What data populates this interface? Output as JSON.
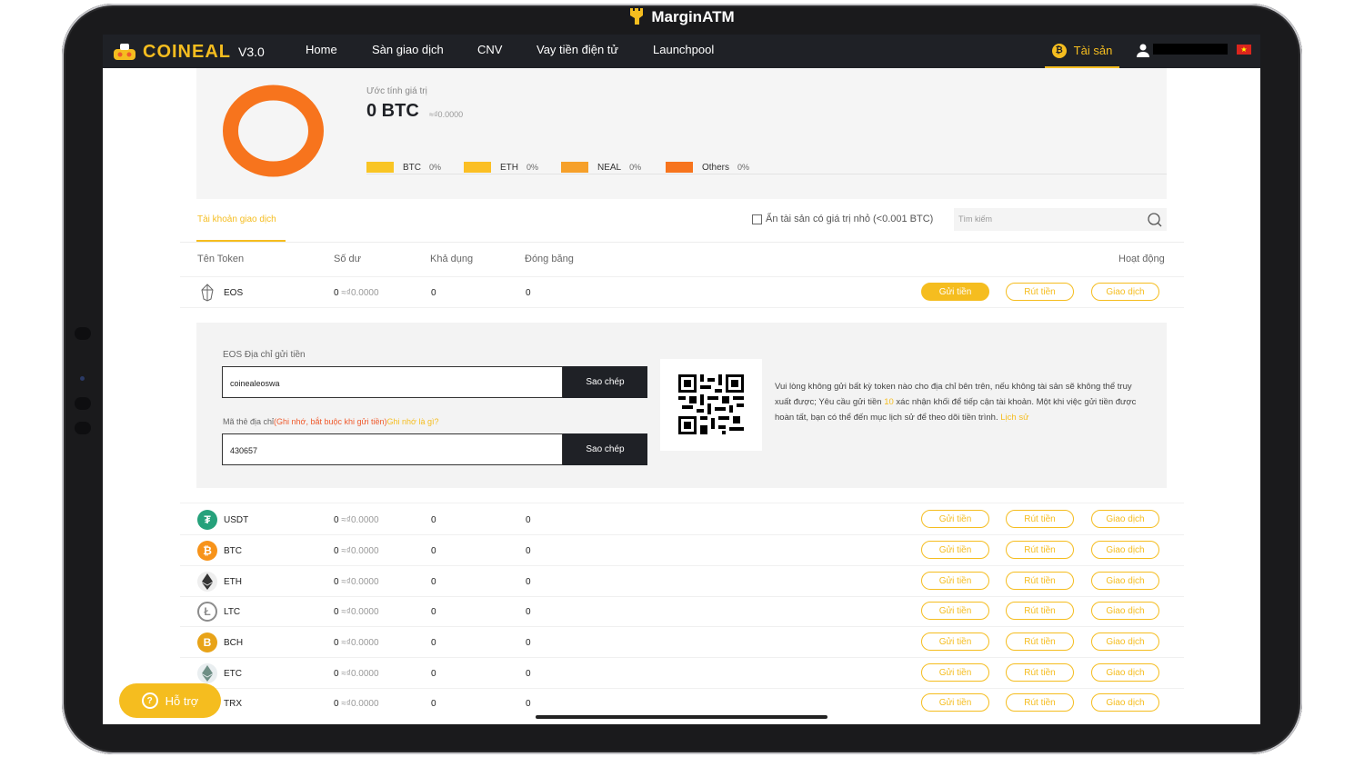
{
  "device": {
    "title": "MarginATM"
  },
  "brand": {
    "name": "COINEAL",
    "version": "V3.0"
  },
  "nav": {
    "items": [
      "Home",
      "Sàn giao dịch",
      "CNV",
      "Vay tiền điện tử",
      "Launchpool"
    ],
    "assets_label": "Tài sản",
    "flag": "★"
  },
  "summary": {
    "label": "Ước tính giá trị",
    "value": "0 BTC",
    "fiat": "≈₫0.0000",
    "legend": [
      {
        "name": "BTC",
        "pct": "0%",
        "color": "#f9c524"
      },
      {
        "name": "ETH",
        "pct": "0%",
        "color": "#fbbf24"
      },
      {
        "name": "NEAL",
        "pct": "0%",
        "color": "#f6a02a"
      },
      {
        "name": "Others",
        "pct": "0%",
        "color": "#f7741d"
      }
    ],
    "donut_color": "#f7741d"
  },
  "tabs": {
    "active": "Tài khoản giao dịch"
  },
  "filters": {
    "hide_small": "Ẩn tài sản có giá trị nhỏ (<0.001 BTC)",
    "search_placeholder": "Tìm kiếm"
  },
  "table": {
    "headers": [
      "Tên Token",
      "Số dư",
      "Khả dụng",
      "Đóng băng",
      "Hoạt động"
    ],
    "actions": [
      "Gửi tiền",
      "Rút tiền",
      "Giao dịch"
    ],
    "rows": [
      {
        "name": "EOS",
        "balance": "0",
        "fiat": "≈₫0.0000",
        "available": "0",
        "frozen": "0",
        "icon": "eos-icon"
      },
      {
        "name": "USDT",
        "balance": "0",
        "fiat": "≈₫0.0000",
        "available": "0",
        "frozen": "0",
        "icon": "usdt-icon"
      },
      {
        "name": "BTC",
        "balance": "0",
        "fiat": "≈₫0.0000",
        "available": "0",
        "frozen": "0",
        "icon": "btc-icon"
      },
      {
        "name": "ETH",
        "balance": "0",
        "fiat": "≈₫0.0000",
        "available": "0",
        "frozen": "0",
        "icon": "eth-icon"
      },
      {
        "name": "LTC",
        "balance": "0",
        "fiat": "≈₫0.0000",
        "available": "0",
        "frozen": "0",
        "icon": "ltc-icon"
      },
      {
        "name": "BCH",
        "balance": "0",
        "fiat": "≈₫0.0000",
        "available": "0",
        "frozen": "0",
        "icon": "bch-icon"
      },
      {
        "name": "ETC",
        "balance": "0",
        "fiat": "≈₫0.0000",
        "available": "0",
        "frozen": "0",
        "icon": "etc-icon"
      },
      {
        "name": "TRX",
        "balance": "0",
        "fiat": "≈₫0.0000",
        "available": "0",
        "frozen": "0",
        "icon": "trx-icon"
      }
    ]
  },
  "deposit": {
    "address_label": "EOS Địa chỉ gửi tiền",
    "address_value": "coinealeoswa",
    "copy_label": "Sao chép",
    "memo_label": "Mã thẻ địa chỉ",
    "memo_warning": "(Ghi nhớ, bắt buộc khi gửi tiền)",
    "memo_help": "Ghi nhớ là gì?",
    "memo_value": "430657",
    "note_1": "Vui lòng không gửi bất kỳ token nào cho địa chỉ bên trên, nếu không tài sản sẽ không thể truy xuất được; Yêu cầu gửi tiền",
    "note_confirm": "10",
    "note_2": "xác nhận khối để tiếp cận tài khoản. Một khi việc gửi tiền được hoàn tất, bạn có thể đến mục lịch sử để theo dõi tiền trình.",
    "note_link": "Lịch sử"
  },
  "support": {
    "label": "Hỗ trợ"
  }
}
